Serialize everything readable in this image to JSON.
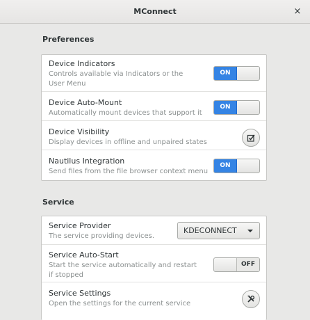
{
  "window": {
    "title": "MConnect",
    "close_label": "×"
  },
  "preferences": {
    "title": "Preferences",
    "rows": [
      {
        "title": "Device Indicators",
        "subtitle": "Controls available via Indicators or the User Menu",
        "control": "switch",
        "state": "ON"
      },
      {
        "title": "Device Auto-Mount",
        "subtitle": "Automatically mount devices that support it",
        "control": "switch",
        "state": "ON"
      },
      {
        "title": "Device Visibility",
        "subtitle": "Display devices in offline and unpaired states",
        "control": "button",
        "icon": "checkbox-icon"
      },
      {
        "title": "Nautilus Integration",
        "subtitle": "Send files from the file browser context menu",
        "control": "switch",
        "state": "ON"
      }
    ]
  },
  "service": {
    "title": "Service",
    "rows": [
      {
        "title": "Service Provider",
        "subtitle": "The service providing devices.",
        "control": "dropdown",
        "value": "KDECONNECT"
      },
      {
        "title": "Service Auto-Start",
        "subtitle": "Start the service automatically and restart if stopped",
        "control": "switch",
        "state": "OFF"
      },
      {
        "title": "Service Settings",
        "subtitle": "Open the settings for the current service",
        "control": "button",
        "icon": "tools-icon"
      }
    ]
  }
}
